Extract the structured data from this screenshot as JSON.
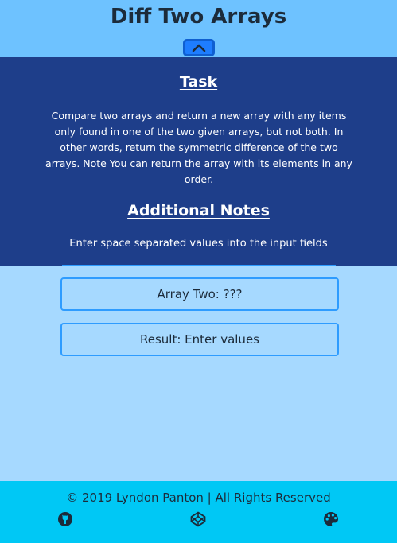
{
  "header": {
    "title": "Diff Two Arrays",
    "toggle_icon": "chevron-up-icon"
  },
  "task": {
    "heading": "Task",
    "text": "Compare two arrays and return a new array with any items only found in one of the two given arrays, but not both. In other words, return the symmetric difference of the two arrays. Note You can return the array with its elements in any order."
  },
  "notes": {
    "heading": "Additional Notes",
    "text": "Enter space separated values into the input fields"
  },
  "outputs": {
    "array_two": "Array Two: ???",
    "result": "Result: Enter values"
  },
  "footer": {
    "copyright": "© 2019 Lyndon Panton | All Rights Reserved",
    "icons": [
      "github-icon",
      "codepen-icon",
      "palette-icon"
    ]
  },
  "colors": {
    "header_bg": "#6ec2ff",
    "panel_bg": "#1e3e8a",
    "body_bg": "#a6d9ff",
    "footer_bg": "#00c8f5",
    "accent": "#1e7dff"
  }
}
